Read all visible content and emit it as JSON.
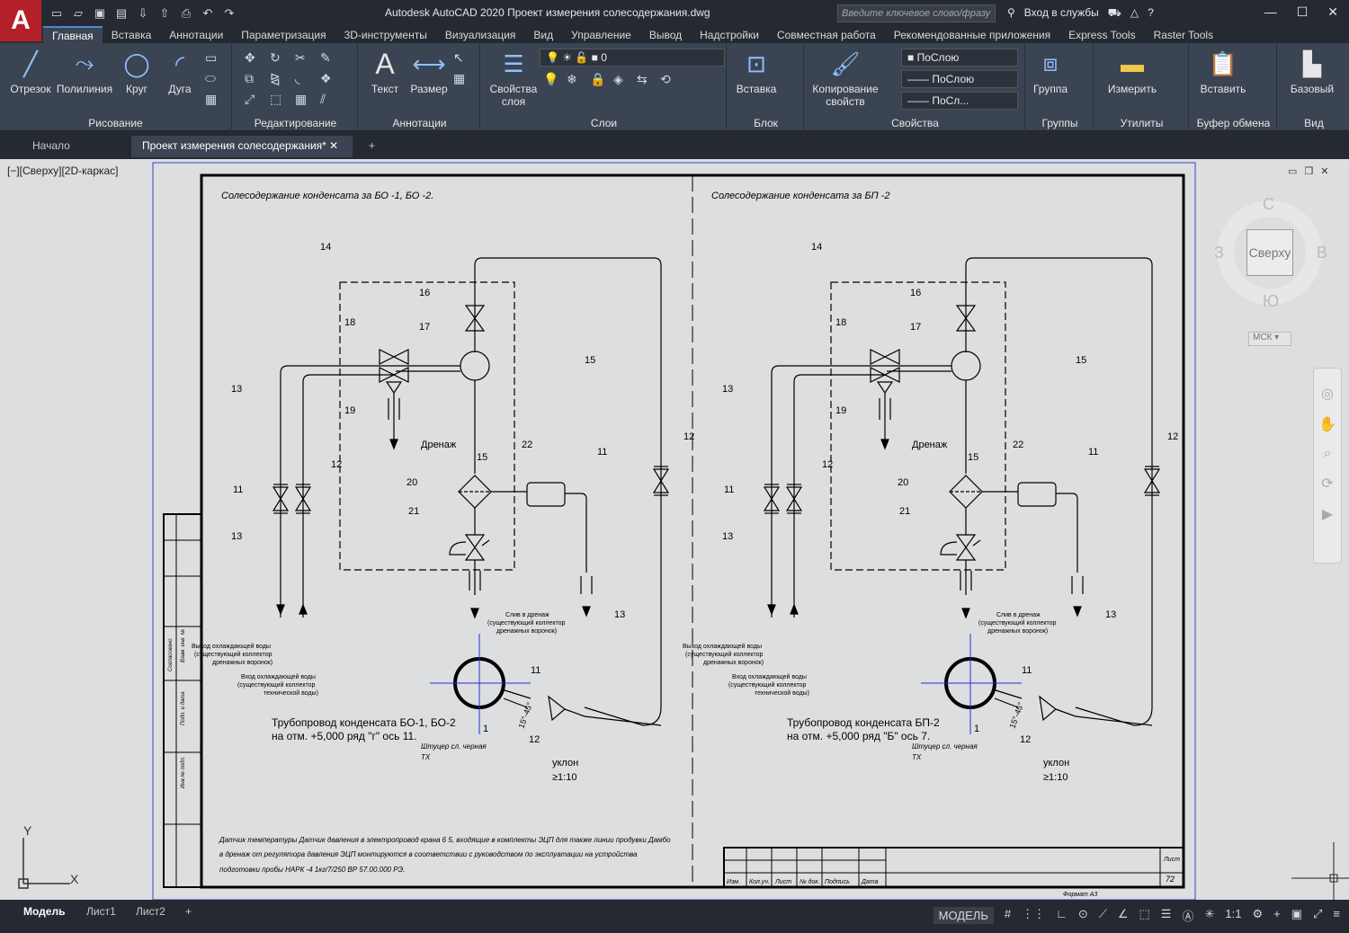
{
  "app": {
    "logo": "A",
    "title": "Autodesk AutoCAD 2020   Проект измерения солесодержания.dwg",
    "search_placeholder": "Введите ключевое слово/фразу",
    "signin": "Вход в службы"
  },
  "qat_icons": [
    "new-icon",
    "open-icon",
    "save-icon",
    "saveas-icon",
    "web-open-icon",
    "web-save-icon",
    "plot-icon",
    "undo-icon",
    "redo-icon"
  ],
  "menu_tabs": [
    "Главная",
    "Вставка",
    "Аннотации",
    "Параметризация",
    "3D-инструменты",
    "Визуализация",
    "Вид",
    "Управление",
    "Вывод",
    "Надстройки",
    "Совместная работа",
    "Рекомендованные приложения",
    "Express Tools",
    "Raster Tools"
  ],
  "ribbon": {
    "draw": {
      "title": "Рисование",
      "line": "Отрезок",
      "polyline": "Полилиния",
      "circle": "Круг",
      "arc": "Дуга"
    },
    "modify": {
      "title": "Редактирование"
    },
    "annot": {
      "title": "Аннотации",
      "text": "Текст",
      "dim": "Размер"
    },
    "layers": {
      "title": "Слои",
      "props": "Свойства слоя",
      "layer_value": "0"
    },
    "block": {
      "title": "Блок",
      "insert": "Вставка"
    },
    "props": {
      "title": "Свойства",
      "copy": "Копирование свойств",
      "color": "ПоСлою",
      "linetype": "ПоСлою",
      "lineweight": "ПоСл..."
    },
    "groups": {
      "title": "Группы",
      "group": "Группа"
    },
    "utils": {
      "title": "Утилиты",
      "measure": "Измерить"
    },
    "clip": {
      "title": "Буфер обмена",
      "paste": "Вставить"
    },
    "view": {
      "title": "Вид",
      "base": "Базовый"
    }
  },
  "doc_tabs": {
    "start": "Начало",
    "current": "Проект измерения солесодержания*"
  },
  "viewport_label": "[−][Сверху][2D-каркас]",
  "viewcube": {
    "n": "С",
    "s": "Ю",
    "w": "З",
    "e": "В",
    "face": "Сверху",
    "wcs": "МСК"
  },
  "drawing": {
    "left_title": "Солесодержание конденсата за БО -1, БО -2.",
    "right_title": "Солесодержание конденсата за БП -2",
    "drain": "Дренаж",
    "drain_note": [
      "Слив в дренаж",
      "(существующий коллектор",
      "дренажных воронок)"
    ],
    "cool_out": [
      "Выход охлаждающей воды",
      "(существующий коллектор",
      "дренажных воронок)"
    ],
    "cool_in": [
      "Вход охлаждающей воды",
      "(существующий коллектор",
      "технической воды)"
    ],
    "left_pipe": [
      "Трубопровод конденсата БО-1, БО-2",
      "на отм. +5,000 ряд \"г\" ось 11."
    ],
    "right_pipe": [
      "Трубопровод конденсата БП-2",
      "на отм. +5,000 ряд \"Б\" ось 7."
    ],
    "slope": [
      "уклон",
      "≥1:10"
    ],
    "angle": "15°-45°",
    "fitting": [
      "Штуцер сл. черная",
      "ТХ"
    ],
    "note": [
      "Датчик температуры Датчик давления в электропровод крана 6 5, входящие в комплекты ЭЦП для также линии продувки Дамбо",
      "в дренаж от регулятора давления ЭЦП монтируются в соответствии с руководством по эксплуатации на устройства",
      "подготовки пробы НАРК -4 1кг/7/250 ВР 57.00.000 РЭ."
    ],
    "stamp": {
      "sheet": "Лист",
      "num": "72",
      "cols": [
        "Изм.",
        "Кол.уч.",
        "Лист",
        "№ док.",
        "Подпись",
        "Дата"
      ],
      "format": "Формат А3"
    },
    "sidebar": [
      "Инв.№ подл.",
      "Подп. и дата",
      "Взам. инв. №",
      "Согласовано"
    ],
    "labels": [
      "14",
      "16",
      "17",
      "18",
      "19",
      "13",
      "11",
      "12",
      "13",
      "20",
      "21",
      "22",
      "15",
      "15",
      "11",
      "12",
      "13",
      "11",
      "1",
      "12"
    ],
    "axis_y": "Y",
    "axis_x": "X"
  },
  "layout_tabs": [
    "Модель",
    "Лист1",
    "Лист2"
  ],
  "status": {
    "mode": "МОДЕЛЬ",
    "scale": "1:1"
  }
}
